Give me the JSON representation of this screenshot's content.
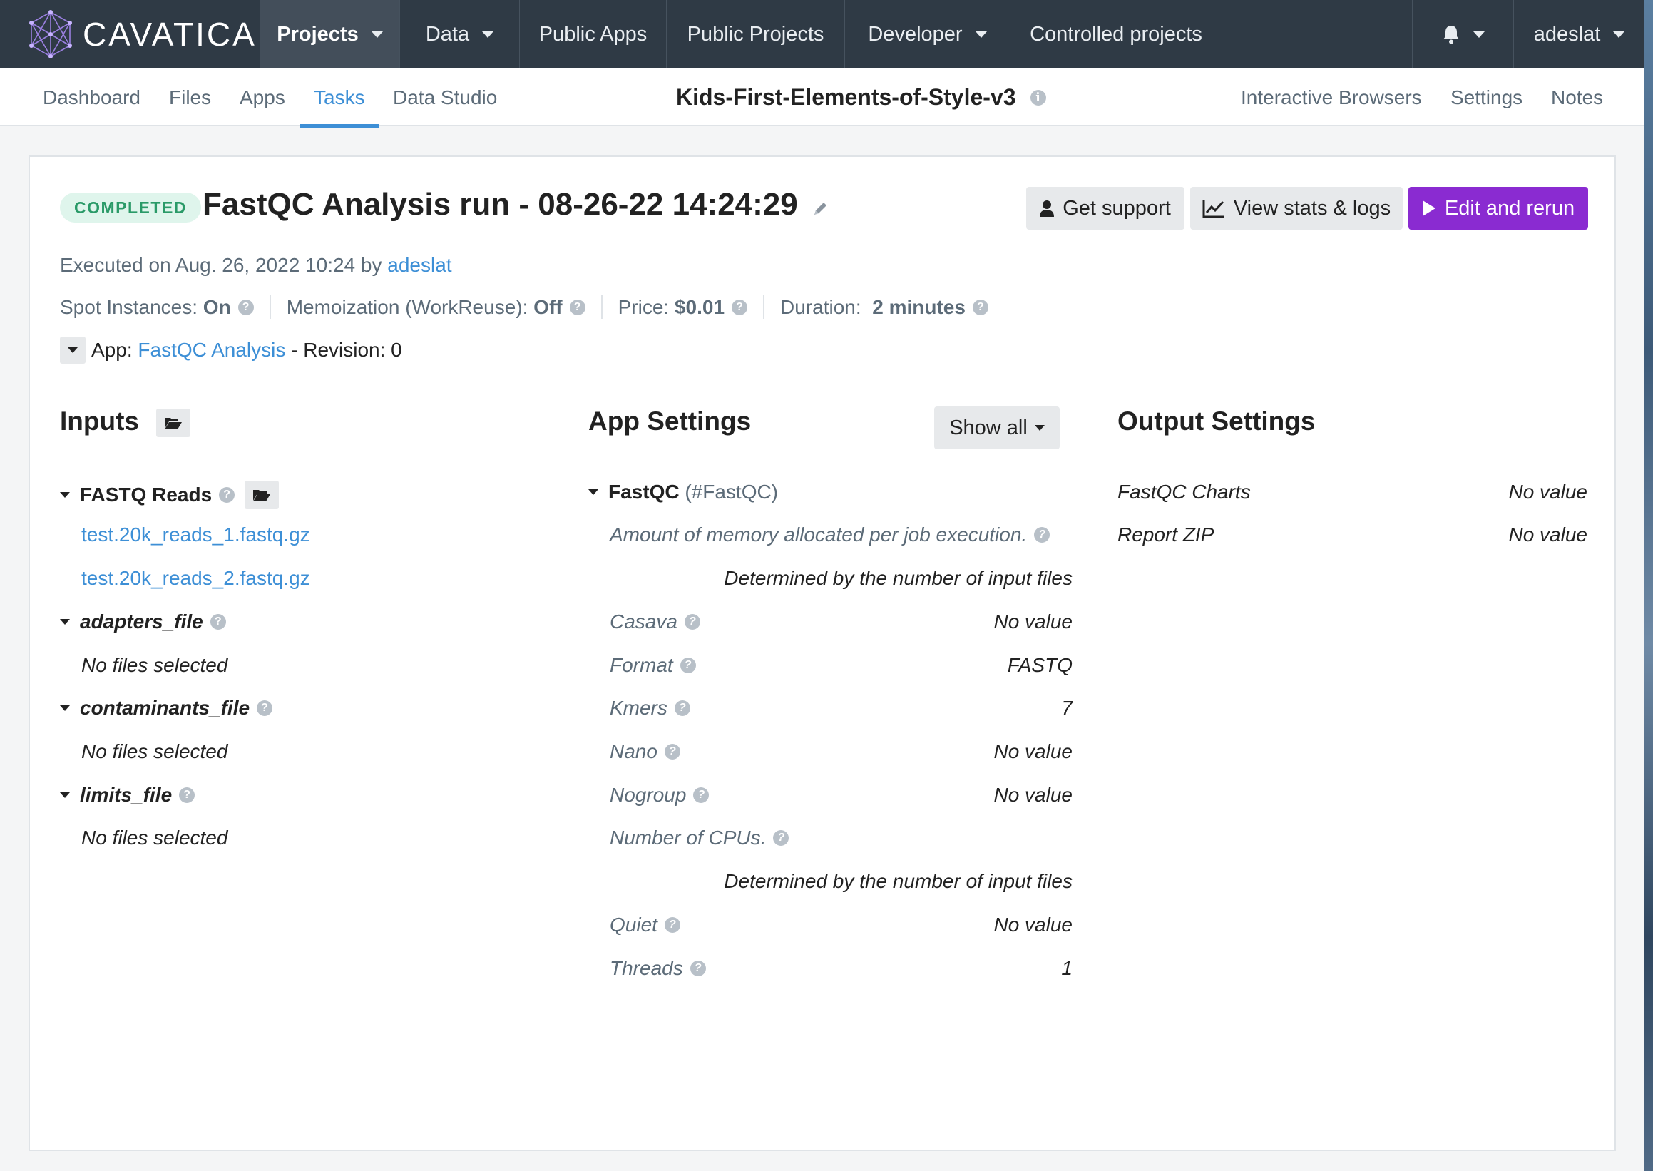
{
  "colors": {
    "nav_bg": "#2f3a45",
    "accent": "#3d8fd6",
    "primary_button": "#8a2bd1",
    "badge_bg": "#dff5ec",
    "badge_text": "#2a9a68"
  },
  "brand": {
    "name": "CAVATICA"
  },
  "topnav": {
    "items": [
      {
        "label": "Projects",
        "dropdown": true,
        "active": true
      },
      {
        "label": "Data",
        "dropdown": true
      },
      {
        "label": "Public Apps"
      },
      {
        "label": "Public Projects"
      },
      {
        "label": "Developer",
        "dropdown": true
      },
      {
        "label": "Controlled projects"
      }
    ],
    "notifications_icon": "bell-icon",
    "user": "adeslat"
  },
  "subnav": {
    "tabs": [
      {
        "label": "Dashboard"
      },
      {
        "label": "Files"
      },
      {
        "label": "Apps"
      },
      {
        "label": "Tasks",
        "active": true
      },
      {
        "label": "Data Studio"
      }
    ],
    "project_title": "Kids-First-Elements-of-Style-v3",
    "right_links": [
      {
        "label": "Interactive Browsers"
      },
      {
        "label": "Settings"
      },
      {
        "label": "Notes"
      }
    ]
  },
  "task": {
    "status": "COMPLETED",
    "title": "FastQC Analysis run - 08-26-22 14:24:29",
    "buttons": {
      "support": "Get support",
      "stats": "View stats & logs",
      "rerun": "Edit and rerun"
    },
    "executed_prefix": "Executed on Aug. 26, 2022 10:24 by",
    "executed_by": "adeslat",
    "stats": {
      "spot_label": "Spot Instances:",
      "spot_value": "On",
      "memo_label": "Memoization (WorkReuse):",
      "memo_value": "Off",
      "price_label": "Price:",
      "price_value": "$0.01",
      "duration_label": "Duration:",
      "duration_value": "2 minutes"
    },
    "app_prefix": "App:",
    "app_name": "FastQC Analysis",
    "app_revision": "- Revision: 0"
  },
  "inputs": {
    "heading": "Inputs",
    "groups": [
      {
        "name": "FASTQ Reads",
        "files": [
          "test.20k_reads_1.fastq.gz",
          "test.20k_reads_2.fastq.gz"
        ]
      },
      {
        "name": "adapters_file",
        "empty": "No files selected"
      },
      {
        "name": "contaminants_file",
        "empty": "No files selected"
      },
      {
        "name": "limits_file",
        "empty": "No files selected"
      }
    ]
  },
  "app_settings": {
    "heading": "App Settings",
    "show_all": "Show all",
    "group_name": "FastQC",
    "group_id": "(#FastQC)",
    "rows": [
      {
        "label": "Amount of memory allocated per job execution.",
        "value": "Determined by the number of input files"
      },
      {
        "label": "Casava",
        "value": "No value"
      },
      {
        "label": "Format",
        "value": "FASTQ"
      },
      {
        "label": "Kmers",
        "value": "7"
      },
      {
        "label": "Nano",
        "value": "No value"
      },
      {
        "label": "Nogroup",
        "value": "No value"
      },
      {
        "label": "Number of CPUs.",
        "value": "Determined by the number of input files"
      },
      {
        "label": "Quiet",
        "value": "No value"
      },
      {
        "label": "Threads",
        "value": "1"
      }
    ]
  },
  "output_settings": {
    "heading": "Output Settings",
    "rows": [
      {
        "label": "FastQC Charts",
        "value": "No value"
      },
      {
        "label": "Report ZIP",
        "value": "No value"
      }
    ]
  }
}
